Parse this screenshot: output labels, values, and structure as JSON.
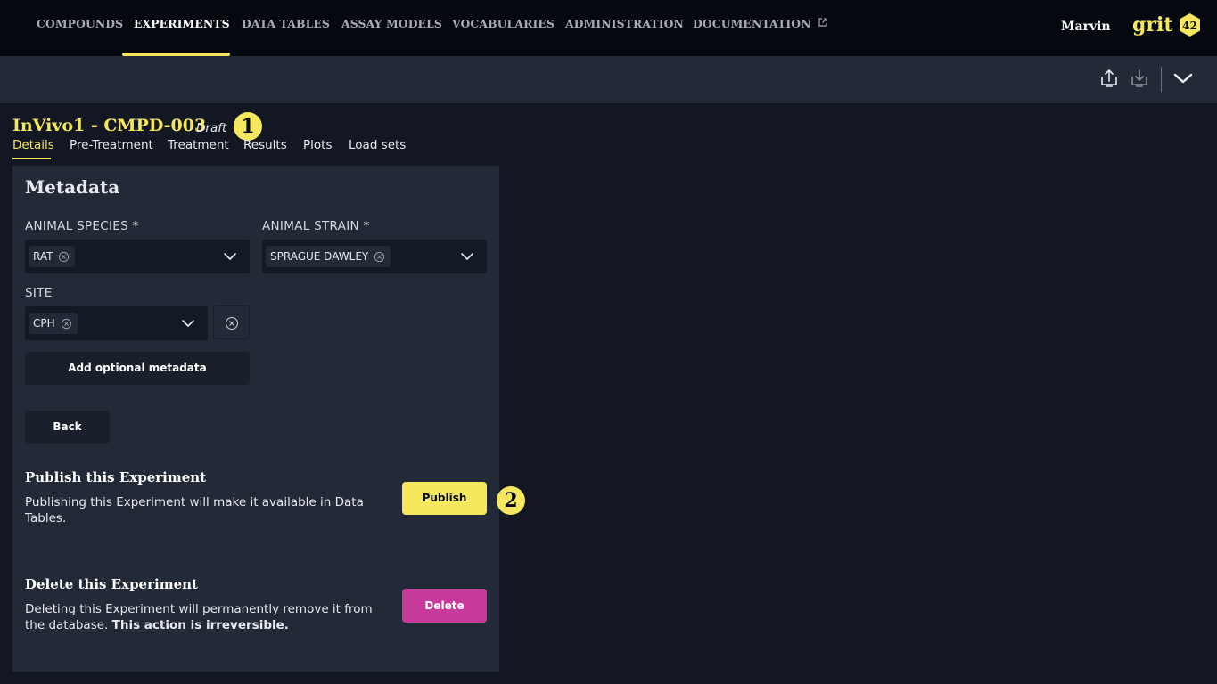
{
  "nav": {
    "items": [
      {
        "label": "COMPOUNDS"
      },
      {
        "label": "EXPERIMENTS"
      },
      {
        "label": "DATA TABLES"
      },
      {
        "label": "ASSAY MODELS"
      },
      {
        "label": "VOCABULARIES"
      },
      {
        "label": "ADMINISTRATION"
      },
      {
        "label": "DOCUMENTATION"
      }
    ],
    "active": "EXPERIMENTS",
    "user": "Marvin",
    "logo_text": "grit",
    "logo_badge": "42"
  },
  "toolbar": {
    "icons": [
      "upload-icon",
      "download-icon",
      "chevron-down-icon"
    ]
  },
  "experiment": {
    "title": "InVivo1 - CMPD-003",
    "status": "Draft"
  },
  "annotations": [
    "1",
    "2"
  ],
  "tabs": [
    {
      "label": "Details",
      "active": true
    },
    {
      "label": "Pre-Treatment"
    },
    {
      "label": "Treatment"
    },
    {
      "label": "Results"
    },
    {
      "label": "Plots"
    },
    {
      "label": "Load sets"
    }
  ],
  "metadata": {
    "heading": "Metadata",
    "animal_species": {
      "label": "ANIMAL SPECIES *",
      "value": "RAT"
    },
    "animal_strain": {
      "label": "ANIMAL STRAIN *",
      "value": "SPRAGUE DAWLEY"
    },
    "site": {
      "label": "SITE",
      "value": "CPH"
    },
    "add_optional": "Add optional metadata",
    "back": "Back"
  },
  "publish": {
    "title": "Publish this Experiment",
    "text": "Publishing this Experiment will make it available in Data Tables.",
    "button": "Publish"
  },
  "delete": {
    "title": "Delete this Experiment",
    "text": "Deleting this Experiment will permanently remove it from the database.",
    "warning": "This action is irreversible.",
    "button": "Delete"
  },
  "colors": {
    "accent": "#f6e75e",
    "danger": "#c73a9c",
    "nav_bg": "#05080e",
    "panel_bg": "#232a37",
    "page_bg": "#121722"
  }
}
